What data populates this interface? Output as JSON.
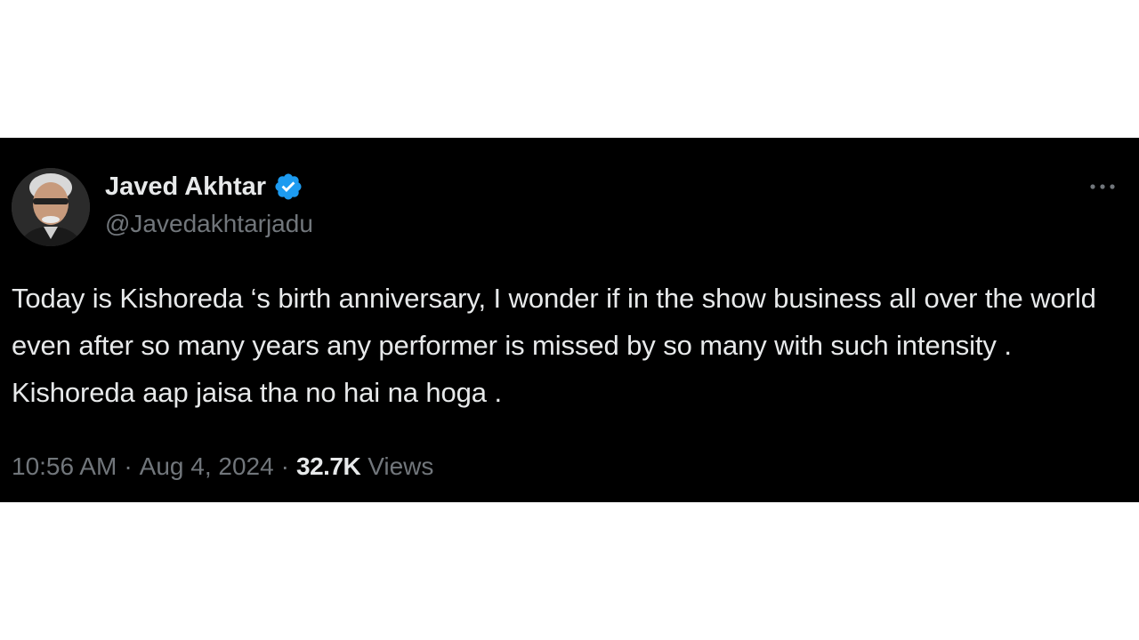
{
  "tweet": {
    "author_name": "Javed Akhtar",
    "author_handle": "@Javedakhtarjadu",
    "verified_icon": "verified-badge-icon",
    "avatar": "avatar-photo",
    "more_icon": "more-options-icon",
    "text": "Today is Kishoreda ‘s birth anniversary, I wonder if in the show business all over the world even after so many years any performer is missed by so many with such intensity . Kishoreda aap jaisa tha no hai na hoga .",
    "time": "10:56 AM",
    "separator": "·",
    "date": "Aug 4, 2024",
    "views_count": "32.7K",
    "views_label": "Views"
  },
  "colors": {
    "card_background": "#000000",
    "page_background": "#ffffff",
    "primary_text": "#e7e9ea",
    "secondary_text": "#71767b",
    "verified_blue": "#1d9bf0"
  }
}
